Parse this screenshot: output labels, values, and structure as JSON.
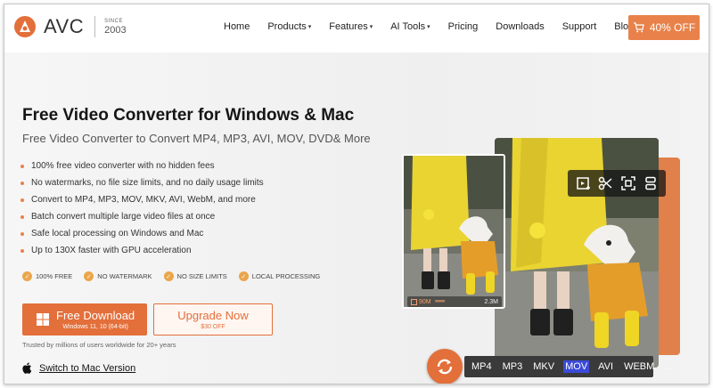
{
  "header": {
    "logo_text": "AVC",
    "since_label": "SINCE",
    "since_year": "2003",
    "nav": [
      {
        "label": "Home",
        "dropdown": false
      },
      {
        "label": "Products",
        "dropdown": true
      },
      {
        "label": "Features",
        "dropdown": true
      },
      {
        "label": "AI Tools",
        "dropdown": true
      },
      {
        "label": "Pricing",
        "dropdown": false
      },
      {
        "label": "Downloads",
        "dropdown": false
      },
      {
        "label": "Support",
        "dropdown": false
      },
      {
        "label": "Blog",
        "dropdown": false
      }
    ],
    "promo_label": "40% OFF"
  },
  "hero": {
    "title": "Free Video Converter for Windows & Mac",
    "subtitle": "Free Video Converter to Convert MP4, MP3, AVI, MOV, DVD& More",
    "features": [
      "100% free video converter with no hidden fees",
      "No watermarks, no file size limits, and no daily usage limits",
      "Convert to MP4, MP3, MOV, MKV, AVI, WebM, and more",
      "Batch convert multiple large video files at once",
      "Safe local processing on Windows and Mac",
      "Up to 130X faster with GPU acceleration"
    ],
    "badges": [
      "100% FREE",
      "NO WATERMARK",
      "NO SIZE LIMITS",
      "LOCAL PROCESSING"
    ],
    "download_button": {
      "label": "Free Download",
      "sub": "Windows 11, 10 (64-bit)"
    },
    "upgrade_button": {
      "label": "Upgrade Now",
      "sub": "$30 OFF"
    },
    "trusted": "Trusted by millions of users worldwide for 20+ years",
    "mac_link": "Switch to Mac Version"
  },
  "preview": {
    "size_from": "90M",
    "size_arrows": "›››››››››››",
    "size_to": "2.3M",
    "formats": [
      "MP4",
      "MP3",
      "MKV",
      "MOV",
      "AVI",
      "WEBM",
      "..."
    ],
    "active_format": "MOV",
    "tools": [
      "trim-icon",
      "cut-icon",
      "crop-icon",
      "merge-icon"
    ]
  },
  "colors": {
    "accent": "#e36f3a",
    "check": "#eaa64a",
    "active_format": "#3b4ad8"
  }
}
